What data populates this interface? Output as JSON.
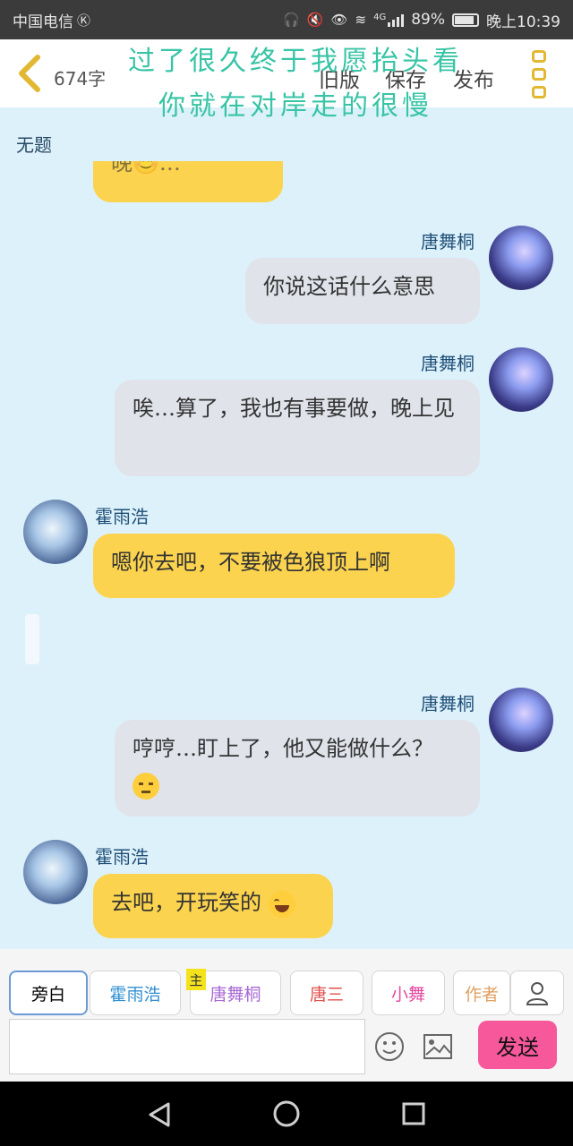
{
  "status_bar": {
    "carrier": "中国电信",
    "battery_percent": "89%",
    "network": "4G",
    "time": "晚上10:39"
  },
  "top_bar": {
    "word_count": "674字",
    "old_version": "旧版",
    "save": "保存",
    "publish": "发布",
    "overlay_line1": "过了很久终于我愿抬头看",
    "overlay_line2": "你就在对岸走的很慢"
  },
  "chat": {
    "title": "无题",
    "messages": [
      {
        "side": "left",
        "name": "",
        "text": "晚😊…"
      },
      {
        "side": "right",
        "name": "唐舞桐",
        "text": "你说这话什么意思"
      },
      {
        "side": "right",
        "name": "唐舞桐",
        "text": "唉…算了，我也有事要做，晚上见"
      },
      {
        "side": "left",
        "name": "霍雨浩",
        "text": "嗯你去吧，不要被色狼顶上啊"
      },
      {
        "side": "right",
        "name": "唐舞桐",
        "text": "哼哼…盯上了，他又能做什么？"
      },
      {
        "side": "left",
        "name": "霍雨浩",
        "text": "去吧，开玩笑的"
      }
    ]
  },
  "composer": {
    "roles": [
      {
        "label": "旁白",
        "color": "#333333"
      },
      {
        "label": "霍雨浩",
        "color": "#2f8fd1"
      },
      {
        "label": "唐舞桐",
        "color": "#a86ad4"
      },
      {
        "label": "唐三",
        "color": "#e0504a"
      },
      {
        "label": "小舞",
        "color": "#e24aa0"
      },
      {
        "label": "作者",
        "color": "#e0a060"
      }
    ],
    "main_badge": "主",
    "input_placeholder": "",
    "send_label": "发送"
  },
  "colors": {
    "chat_bg": "#ddf1fb",
    "left_bubble": "#fbd34e",
    "right_bubble": "#e0e3ea",
    "send_button": "#f6589b",
    "accent_yellow": "#e2b832"
  }
}
